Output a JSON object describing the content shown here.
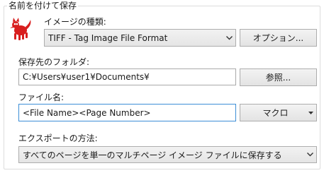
{
  "group": {
    "title": "名前を付けて保存"
  },
  "icons": {
    "app_logo": "irfanview-cat-icon",
    "dropdown_arrow": "chevron-down-icon"
  },
  "image_type": {
    "label": "イメージの種類:",
    "selected": "TIFF - Tag Image File Format"
  },
  "options_button": {
    "label": "オプション..."
  },
  "folder": {
    "label": "保存先のフォルダ:",
    "value": "C:¥Users¥user1¥Documents¥"
  },
  "browse_button": {
    "label": "参照..."
  },
  "filename": {
    "label": "ファイル名:",
    "value": "<File Name><Page Number>"
  },
  "macro_button": {
    "label": "マクロ"
  },
  "export_method": {
    "label": "エクスポートの方法:",
    "selected": "すべてのページを単一のマルチページ イメージ ファイルに保存する"
  },
  "colors": {
    "accent_focus": "#3c8ed6",
    "logo_red": "#d81e1e"
  }
}
